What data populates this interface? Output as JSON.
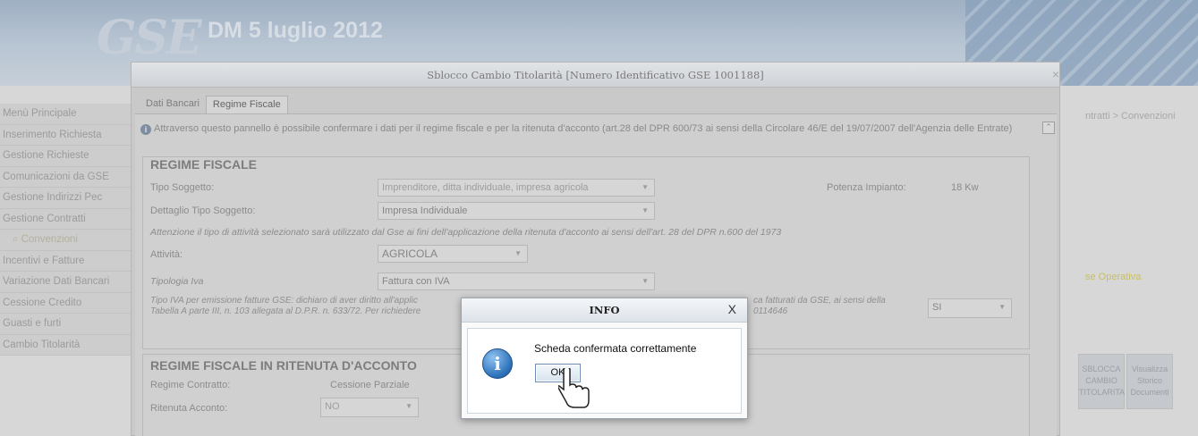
{
  "app": {
    "logo": "GSE",
    "title": "DM 5 luglio 2012"
  },
  "sidebar": {
    "items": [
      {
        "label": "Menù Principale"
      },
      {
        "label": "Inserimento Richiesta"
      },
      {
        "label": "Gestione Richieste"
      },
      {
        "label": "Comunicazioni da GSE"
      },
      {
        "label": "Gestione Indirizzi Pec"
      },
      {
        "label": "Gestione Contratti"
      },
      {
        "label": "Convenzioni"
      },
      {
        "label": "Incentivi e Fatture"
      },
      {
        "label": "Variazione Dati Bancari"
      },
      {
        "label": "Cessione Credito"
      },
      {
        "label": "Guasti e furti"
      },
      {
        "label": "Cambio Titolarità"
      }
    ]
  },
  "right_area": {
    "breadcrumb": "ntratti > Convenzioni",
    "sede": "se Operativa",
    "buttons": [
      "SBLOCCA CAMBIO TITOLARITA",
      "Visualizza Storico Documenti"
    ]
  },
  "dialog": {
    "title": "Sblocco Cambio Titolarità [Numero Identificativo GSE 1001188]",
    "close": "×",
    "tabs": [
      {
        "label": "Dati Bancari",
        "active": false
      },
      {
        "label": "Regime Fiscale",
        "active": true
      }
    ],
    "info_text": "Attraverso questo pannello è possibile confermare i dati per il regime fiscale e per la ritenuta d'acconto (art.28 del DPR 600/73 ai sensi della Circolare 46/E del 19/07/2007 dell'Agenzia delle Entrate)",
    "regime_fiscale": {
      "legend": "REGIME FISCALE",
      "tipo_soggetto_label": "Tipo Soggetto:",
      "tipo_soggetto_value": "Imprenditore, ditta individuale, impresa agricola",
      "potenza_label": "Potenza Impianto:",
      "potenza_value": "18 Kw",
      "dettaglio_label": "Dettaglio Tipo Soggetto:",
      "dettaglio_value": "Impresa Individuale",
      "attenzione_note": "Attenzione il tipo di attività selezionato sarà utilizzato dal Gse ai fini dell'applicazione della ritenuta d'acconto ai sensi dell'art. 28 del DPR n.600 del 1973",
      "attivita_label": "Attività:",
      "attivita_value": "AGRICOLA",
      "tipologia_iva_label": "Tipologia Iva",
      "tipologia_iva_value": "Fattura con IVA",
      "tipo_iva_note_left": "Tipo IVA per emissione fatture GSE: dichiaro di aver diritto all'applic",
      "tipo_iva_note_left2": "Tabella A parte III, n. 103 allegata al D.P.R. n. 633/72. Per richiedere",
      "tipo_iva_note_right": "ca fatturati da GSE, ai sensi della",
      "tipo_iva_note_right2": "0114646",
      "si_value": "SI"
    },
    "ritenuta": {
      "legend": "REGIME FISCALE IN RITENUTA D'ACCONTO",
      "regime_contratto_label": "Regime Contratto:",
      "regime_contratto_value": "Cessione Parziale",
      "ritenuta_label": "Ritenuta Acconto:",
      "ritenuta_value": "NO"
    }
  },
  "modal": {
    "title": "INFO",
    "close": "X",
    "message": "Scheda confermata correttamente",
    "ok_label": "OK",
    "icon": "info-icon"
  }
}
